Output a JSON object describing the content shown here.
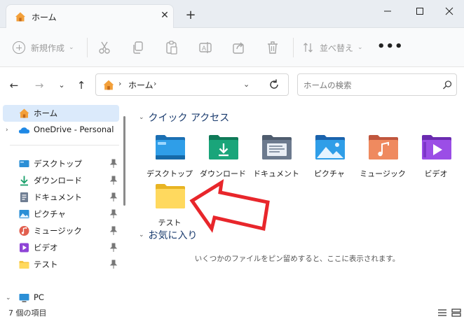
{
  "tab": {
    "title": "ホーム"
  },
  "window": {
    "minimize": "—",
    "maximize": "☐",
    "close": "✕"
  },
  "toolbar": {
    "new_label": "新規作成",
    "sort_label": "並べ替え",
    "more": "•••"
  },
  "address": {
    "path": "ホーム",
    "sep": "›"
  },
  "search": {
    "placeholder": "ホームの検索"
  },
  "sidebar": {
    "items": [
      {
        "label": "ホーム",
        "selected": true
      },
      {
        "label": "OneDrive - Personal"
      },
      {
        "label": "デスクトップ"
      },
      {
        "label": "ダウンロード"
      },
      {
        "label": "ドキュメント"
      },
      {
        "label": "ピクチャ"
      },
      {
        "label": "ミュージック"
      },
      {
        "label": "ビデオ"
      },
      {
        "label": "テスト"
      },
      {
        "label": "PC"
      }
    ]
  },
  "main": {
    "quick_access": {
      "title": "クイック アクセス",
      "items": [
        {
          "label": "デスクトップ",
          "icon": "desktop-folder-icon"
        },
        {
          "label": "ダウンロード",
          "icon": "downloads-folder-icon"
        },
        {
          "label": "ドキュメント",
          "icon": "documents-folder-icon"
        },
        {
          "label": "ピクチャ",
          "icon": "pictures-folder-icon"
        },
        {
          "label": "ミュージック",
          "icon": "music-folder-icon"
        },
        {
          "label": "ビデオ",
          "icon": "videos-folder-icon"
        },
        {
          "label": "テスト",
          "icon": "folder-icon"
        }
      ]
    },
    "favorites": {
      "title": "お気に入り",
      "empty_message": "いくつかのファイルをピン留めすると、ここに表示されます。"
    }
  },
  "status": {
    "item_count": "7 個の項目"
  },
  "colors": {
    "accent": "#0067c0",
    "selected_bg": "#dbeafb",
    "arrow": "#e8262b"
  }
}
